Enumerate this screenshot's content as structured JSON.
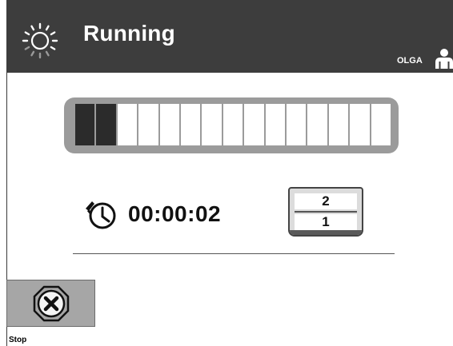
{
  "header": {
    "status_title": "Running",
    "user_name": "OLGA",
    "icons": {
      "status": "spinner-icon",
      "user": "user-icon"
    }
  },
  "progress": {
    "total_segments": 15,
    "filled_segments": 2,
    "fraction": 0.133
  },
  "timer": {
    "icon": "stopwatch-icon",
    "elapsed": "00:00:02"
  },
  "counter": {
    "top_value": "2",
    "bottom_value": "1"
  },
  "stop": {
    "label": "Stop",
    "icon": "close-circle-icon"
  },
  "colors": {
    "header_bg": "#3d3d3d",
    "progress_track": "#9b9b9b",
    "progress_fill": "#2b2b2b",
    "button_bg": "#a6a6a6"
  }
}
